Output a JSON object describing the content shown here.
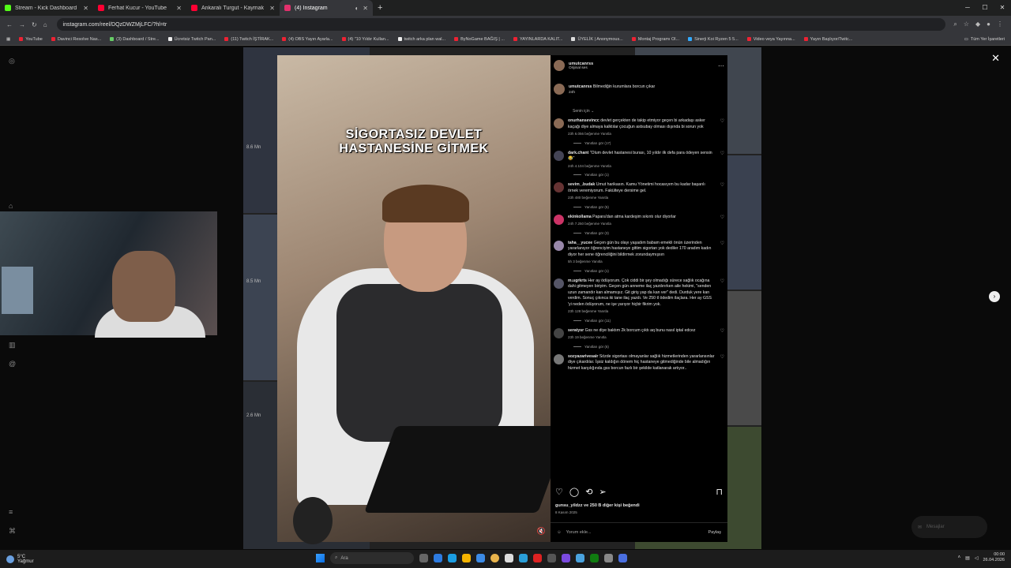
{
  "browser": {
    "tabs": [
      {
        "title": "Stream - Kick Dashboard",
        "color": "#53fc18"
      },
      {
        "title": "Ferhat Kucur - YouTube",
        "color": "#ff0033"
      },
      {
        "title": "Ankaralı Turgut - Kaymak Lazım",
        "color": "#ff0033"
      },
      {
        "title": "(4) Instagram",
        "color": "#e1306c"
      }
    ],
    "new_tab": "+",
    "url": "instagram.com/reel/DQzDWZMjLFC/?hl=tr",
    "bookmarks": [
      "YouTube",
      "Davinci Resolve Nas...",
      "(3) Dashboard / Stre...",
      "Ücretsiz Twitch Pan...",
      "(11) Twitch İŞTİRAK...",
      "(4) OBS Yayın Ayarla...",
      "(4) \"10 Yıldır Kullan...",
      "twitch arka plan wal...",
      "ByNoGame BAĞIŞ | ...",
      "YAYINLARDA KALIT...",
      "ÜYELİK | Anonymous...",
      "Montaj Programı Ol...",
      "Sinerji Koi Ryzen 5 5...",
      "Video veya Yayınna...",
      "Yayın Başlıyor/Twitc..."
    ],
    "all_bookmarks": "Tüm Yer İşaretleri"
  },
  "video": {
    "overlay_line1": "SİGORTASIZ DEVLET",
    "overlay_line2": "HASTANESİNE GİTMEK",
    "mute_icon": "🔇"
  },
  "bg_counts": [
    "8.6 Mn",
    "8.5 Mn",
    "2.6 Mn"
  ],
  "post": {
    "author": "umutcanrss",
    "audio": "Orijinal ses",
    "caption": "Bilmediğin kurumlara borcun çıkar",
    "caption_time": "24h",
    "sort_label": "Senin için",
    "likes": "gunsu_yildzz ve 250 B diğer kişi beğendi",
    "date": "8 Kasım 2025",
    "add_comment": "Yorum ekle...",
    "share": "Paylaş"
  },
  "comments": [
    {
      "user": "onurhansevincc",
      "text": "devlet gerçekten de takip etmiyor geçen bi arkadaşı asker kaçağı diye almaya kalktılar çocuğun astsubay olması dışında bi sorun yok",
      "meta": "23h   6.056 beğenme   Yanıtla",
      "replies": "Yanıtları gör (17)"
    },
    {
      "user": "dark.chant",
      "text": "\"Olum devlet hastanesi burası, 10 yıldır ilk defa para ödeyen sensin😂\"",
      "meta": "24h   4.104 beğenme   Yanıtla",
      "replies": "Yanıtları gör (1)"
    },
    {
      "user": "sevim_.budak",
      "text": "Umut harikasın. Kamu Yönetimi hocasıyım bu kadar başarılı örnek veremiyorum. Fakülteye dersime gel.",
      "meta": "23h   480 beğenme   Yanıtla",
      "replies": "Yanıtları gör (5)"
    },
    {
      "user": "ekinkollama",
      "text": "Papara'dan atma kardeşim sıkıntı olur diyorlar",
      "meta": "24h   7.250 beğenme   Yanıtla",
      "replies": "Yanıtları gör (3)"
    },
    {
      "user": "taha__yucee",
      "text": "Geçen gün bu olayı yaşadım babam emekli önün üzerinden yararlanıyor öğrenciyim hastaneye gittim sigortan yok dediler 170 aradım kadın diyor her sene öğrenciliğini bildirmek zorundaymışsın",
      "meta": "5h   3 beğenme   Yanıtla",
      "replies": "Yanıtları gör (1)"
    },
    {
      "user": "m.ugrkrts",
      "text": "Her ay ödüyorum. Çok ciddi bir şey olmadığı sürece sağlık ocağına dahi gitmeyen biriyim. Geçen gün anneme ilaç yazdırırken aile hekimi, \"senden uzun zamandır kan almamışız. Git giriş yap da kan ver\" dedi. Durduk yere kan verdim. Sonuç çıkınca iki tane ilaç yazdı. Ve 250 tl ödedim ilaçlara. Her ay GSS 'yi neden ödüyorum, ne işe yarıyor hiçbir fikrim yok.",
      "meta": "23h   128 beğenme   Yanıtla",
      "replies": "Yanıtları gör (11)"
    },
    {
      "user": "seratysr",
      "text": "Gss ne diye baktım 2k borcum çıktı aq bunu nasıl iptal edcez",
      "meta": "23h   19 beğenme   Yanıtla",
      "replies": "Yanıtları gör (6)"
    },
    {
      "user": "sozyazarivesair",
      "text": "Sözde sigortası olmayanlar sağlık hizmetlerinden yararlansınlar diye çıkardılar. İşsiz kaldığın dönem hiç hastaneye gitmediğinde bile almadığın hizmet karşılığında gss borcun fazlı bir şekilde katlanarak artıyor..",
      "meta": "",
      "replies": ""
    }
  ],
  "messages": "Mesajlar",
  "taskbar": {
    "weather_temp": "5°C",
    "weather_desc": "Yağmur",
    "search": "Ara",
    "time": "00:00",
    "date": "26.04.2026"
  },
  "colors": {
    "accent": "#0095f6",
    "bg": "#000000"
  }
}
